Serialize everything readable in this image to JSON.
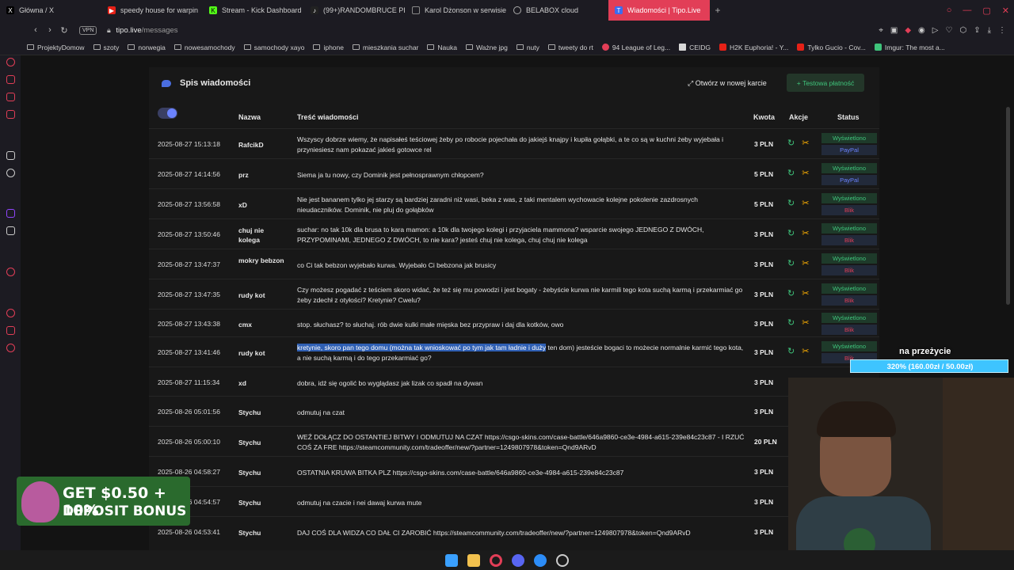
{
  "tabs": [
    {
      "title": "Główna / X",
      "icon": "x-logo-icon",
      "color": "#000000"
    },
    {
      "title": "speedy house for warpin",
      "icon": "youtube-icon",
      "color": "#e62117"
    },
    {
      "title": "Stream - Kick Dashboard",
      "icon": "kick-icon",
      "color": "#53fc18"
    },
    {
      "title": "(99+)RANDOMBRUCE PI",
      "icon": "tiktok-icon",
      "color": "#222222"
    },
    {
      "title": "Karol Dżonson w serwisie",
      "icon": "page-icon",
      "color": "#555555"
    },
    {
      "title": "BELABOX cloud",
      "icon": "globe-icon",
      "color": "#555555"
    },
    {
      "title": "Wiadomości | Tipo.Live",
      "icon": "tipo-icon",
      "color": "#3b6cf0"
    }
  ],
  "address": {
    "vpn": "VPN",
    "domain": "tipo.live",
    "path": "/messages"
  },
  "bookmarks": [
    {
      "label": "ProjektyDomow",
      "kind": "folder"
    },
    {
      "label": "szoty",
      "kind": "folder"
    },
    {
      "label": "norwegia",
      "kind": "folder"
    },
    {
      "label": "nowesamochody",
      "kind": "folder"
    },
    {
      "label": "samochody xayo",
      "kind": "folder"
    },
    {
      "label": "iphone",
      "kind": "folder"
    },
    {
      "label": "mieszkania suchar",
      "kind": "folder"
    },
    {
      "label": "Nauka",
      "kind": "folder"
    },
    {
      "label": "Ważne jpg",
      "kind": "folder"
    },
    {
      "label": "nuty",
      "kind": "folder"
    },
    {
      "label": "tweety do rt",
      "kind": "folder"
    },
    {
      "label": "94 League of Leg...",
      "kind": "site"
    },
    {
      "label": "CEIDG",
      "kind": "site"
    },
    {
      "label": "H2K Euphoria! - Y...",
      "kind": "site"
    },
    {
      "label": "Tylko Gucio - Cov...",
      "kind": "site"
    },
    {
      "label": "Imgur: The most a...",
      "kind": "site"
    }
  ],
  "panel": {
    "title": "Spis wiadomości",
    "open_new_tab": "Otwórz w nowej karcie",
    "test_payment": "Testowa płatność"
  },
  "table": {
    "headers": {
      "name": "Nazwa",
      "message": "Treść wiadomości",
      "amount": "Kwota",
      "actions": "Akcje",
      "status": "Status"
    },
    "rows": [
      {
        "date": "2025-08-27 15:13:18",
        "name": "RafcikD",
        "message": "Wszyscy dobrze wiemy, że napisałeś teściowej żeby po robocie pojechała do jakiejś knajpy i kupiła gołąbki, a te co są w kuchni żeby wyjebała i przyniesiesz nam pokazać jakieś gotowce rel",
        "amount": "3 PLN",
        "status": "Wyświetlono",
        "method": "PayPal"
      },
      {
        "date": "2025-08-27 14:14:56",
        "name": "prz",
        "message": "Siema ja tu nowy, czy Dominik jest pełnosprawnym chłopcem?",
        "amount": "5 PLN",
        "status": "Wyświetlono",
        "method": "PayPal"
      },
      {
        "date": "2025-08-27 13:56:58",
        "name": "xD",
        "message": "Nie jest bananem tylko jej starzy są bardziej zaradni niż wasi, beka z was, z taki mentalem wychowacie kolejne pokolenie zazdrosnych nieudaczników. Dominik, nie pluj do gołąbków",
        "amount": "5 PLN",
        "status": "Wyświetlono",
        "method": "Blik"
      },
      {
        "date": "2025-08-27 13:50:46",
        "name": "chuj nie kolega",
        "message": "suchar: no tak 10k dla brusa to kara mamon: a 10k dla twojego kolegi i przyjaciela mammona? wsparcie swojego JEDNEGO Z DWÓCH, PRZYPOMINAMI, JEDNEGO Z DWÓCH, to nie kara? jesteś chuj nie kolega, chuj chuj nie kolega",
        "amount": "3 PLN",
        "status": "Wyświetlono",
        "method": "Blik"
      },
      {
        "date": "2025-08-27 13:47:37",
        "name": "mokry bebzon",
        "message": "co Ci tak bebzon wyjebało kurwa. Wyjebało Ci bebzona jak brusicy",
        "amount": "3 PLN",
        "status": "Wyświetlono",
        "method": "Blik"
      },
      {
        "date": "2025-08-27 13:47:35",
        "name": "rudy kot",
        "message": "Czy możesz pogadać z teściem skoro widać, że też się mu powodzi i jest bogaty - żebyście kurwa nie karmili tego kota suchą karmą i przekarmiać go żeby zdechł z otyłości? Kretynie? Cwelu?",
        "amount": "3 PLN",
        "status": "Wyświetlono",
        "method": "Blik"
      },
      {
        "date": "2025-08-27 13:43:38",
        "name": "cmx",
        "message": "stop. słuchasz? to słuchaj. rób dwie kulki małe mięska bez przypraw i daj dla kotków, owo",
        "amount": "3 PLN",
        "status": "Wyświetlono",
        "method": "Blik"
      },
      {
        "date": "2025-08-27 13:41:46",
        "name": "rudy kot",
        "message_hl": "kretynie, skoro pan tego domu (można tak wnioskować po tym jak tam ładnie i duży",
        "message": " ten dom) jesteście bogaci to możecie normalnie karmić tego kota, a nie suchą karmą i do tego przekarmiać go?",
        "amount": "3 PLN",
        "status": "Wyświetlono",
        "method": "Blik"
      },
      {
        "date": "2025-08-27 11:15:34",
        "name": "xd",
        "message": "dobra, idź się ogolić bo wyglądasz jak lizak co spadł na dywan",
        "amount": "3 PLN"
      },
      {
        "date": "2025-08-26 05:01:56",
        "name": "Stychu",
        "message": "odmutuj na czat",
        "amount": "3 PLN"
      },
      {
        "date": "2025-08-26 05:00:10",
        "name": "Stychu",
        "message": "WEŹ DOŁĄCZ DO OSTANTIEJ BITWY I ODMUTUJ NA CZAT https://csgo-skins.com/case-battle/646a9860-ce3e-4984-a615-239e84c23c87 - I RZUĆ COŚ ZA FRE https://steamcommunity.com/tradeoffer/new/?partner=1249807978&token=Qnd9ARvD",
        "amount": "20 PLN"
      },
      {
        "date": "2025-08-26 04:58:27",
        "name": "Stychu",
        "message": "OSTATNIA KRUWA BITKA PLZ https://csgo-skins.com/case-battle/646a9860-ce3e-4984-a615-239e84c23c87",
        "amount": "3 PLN"
      },
      {
        "date": "2025-08-26 04:54:57",
        "name": "Stychu",
        "message": "odmutuj na czacie i nei dawaj kurwa mute",
        "amount": "3 PLN"
      },
      {
        "date": "2025-08-26 04:53:41",
        "name": "Stychu",
        "message": "DAJ COŚ DLA WIDZA CO DAŁ CI ZAROBIĆ https://steamcommunity.com/tradeoffer/new/?partner=1249807978&token=Qnd9ARvD",
        "amount": "3 PLN"
      }
    ]
  },
  "goal": {
    "label": "na przeżycie",
    "progress_text": "320% (160.00zł / 50.00zł)",
    "progress_fraction": 3.2
  },
  "promo": {
    "line1": "GET $0.50 + 10%",
    "line2": "DEPOSIT BONUS"
  },
  "colors": {
    "accent": "#e23e57",
    "green": "#3fc47b",
    "orange": "#ffb000",
    "paypal": "#6b83ff",
    "blik": "#e23e57"
  }
}
